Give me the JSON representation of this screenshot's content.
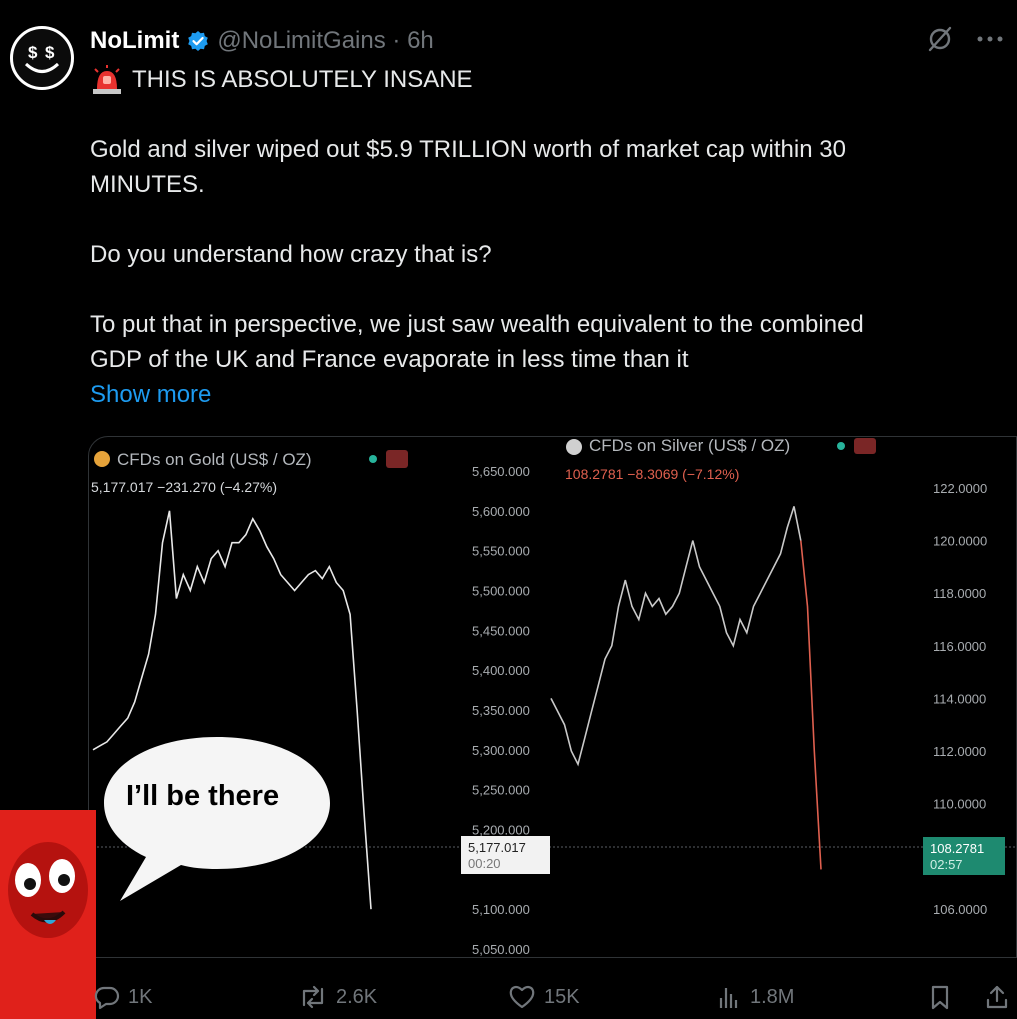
{
  "tweet": {
    "author_name": "NoLimit",
    "handle_time": "@NoLimitGains · 6h",
    "headline": "THIS IS ABSOLUTELY INSANE",
    "line1": "Gold and silver wiped out $5.9 TRILLION worth of market cap within 30",
    "line2": "MINUTES.",
    "line3": "Do you understand how crazy that is?",
    "line4": "To put that in perspective, we just saw wealth equivalent to the combined",
    "line5": "GDP of the UK and France evaporate in less time than it",
    "show_more": "Show more"
  },
  "meme": {
    "speech": "I’ll be there"
  },
  "actions": {
    "replies": "1K",
    "reposts": "2.6K",
    "likes": "15K",
    "views": "1.8M"
  },
  "colors": {
    "accent": "#1d9bf0",
    "muted": "#71767b",
    "silver_down": "#e0604f",
    "silver_price_badge": "#1e8a70"
  },
  "chart_data": [
    {
      "type": "line",
      "title": "CFDs on Gold (US$ / OZ)",
      "quote": "5,177.017  −231.270 (−4.27%)",
      "ylim": [
        5050,
        5650
      ],
      "yticks": [
        "5,650.000",
        "5,600.000",
        "5,550.000",
        "5,500.000",
        "5,450.000",
        "5,400.000",
        "5,350.000",
        "5,300.000",
        "5,250.000",
        "5,200.000",
        "5,100.000",
        "5,050.000"
      ],
      "ytick_values": [
        5650,
        5600,
        5550,
        5500,
        5450,
        5400,
        5350,
        5300,
        5250,
        5200,
        5100,
        5050
      ],
      "last_price": "5,177.017",
      "last_price_value": 5177.017,
      "last_time": "00:20",
      "y": [
        5300,
        5305,
        5310,
        5320,
        5330,
        5340,
        5360,
        5390,
        5420,
        5470,
        5560,
        5600,
        5490,
        5520,
        5500,
        5530,
        5510,
        5540,
        5550,
        5530,
        5560,
        5560,
        5570,
        5590,
        5575,
        5555,
        5540,
        5520,
        5510,
        5500,
        5510,
        5520,
        5525,
        5515,
        5530,
        5510,
        5500,
        5470,
        5350,
        5220,
        5100
      ]
    },
    {
      "type": "line",
      "title": "CFDs on Silver (US$ / OZ)",
      "quote": "108.2781  −8.3069 (−7.12%)",
      "ylim": [
        105,
        124
      ],
      "yticks": [
        "122.0000",
        "120.0000",
        "118.0000",
        "116.0000",
        "114.0000",
        "112.0000",
        "110.0000",
        "106.0000"
      ],
      "ytick_values": [
        122,
        120,
        118,
        116,
        114,
        112,
        110,
        106
      ],
      "last_price": "108.2781",
      "last_price_value": 108.2781,
      "last_time": "02:57",
      "y": [
        114.0,
        113.5,
        113.0,
        112.0,
        111.5,
        112.5,
        113.5,
        114.5,
        115.5,
        116.0,
        117.5,
        118.5,
        117.5,
        117.0,
        118.0,
        117.5,
        117.8,
        117.2,
        117.5,
        118.0,
        119.0,
        120.0,
        119.0,
        118.5,
        118.0,
        117.5,
        116.5,
        116.0,
        117.0,
        116.5,
        117.5,
        118.0,
        118.5,
        119.0,
        119.5,
        120.5,
        121.3,
        120.0,
        117.5,
        112.0,
        107.5
      ]
    }
  ]
}
